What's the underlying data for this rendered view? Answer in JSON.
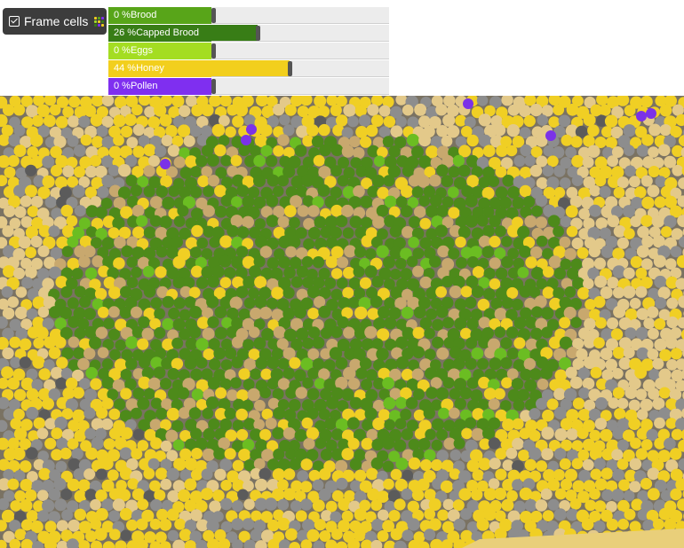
{
  "toggle": {
    "label": "Frame cells",
    "checked": true
  },
  "stats": [
    {
      "label": "0 %Brood",
      "percent": 0,
      "color": "#58a519"
    },
    {
      "label": "26 %Capped Brood",
      "percent": 26,
      "color": "#387d16"
    },
    {
      "label": "0 %Eggs",
      "percent": 0,
      "color": "#a4dd22"
    },
    {
      "label": "44 %Honey",
      "percent": 44,
      "color": "#f2cf1d"
    },
    {
      "label": "0 %Pollen",
      "percent": 0,
      "color": "#7f2ff0"
    }
  ],
  "colors": {
    "capped_brood": "#4d8a1a",
    "brood": "#6bbd22",
    "honey": "#f0cf24",
    "pollen": "#7b32e8",
    "empty_light": "#e3c98a",
    "empty_dark": "#8d8d8d",
    "wax": "#c8a86e"
  },
  "icons": {
    "toggle": "checkbox-icon",
    "cells": "grid-icon"
  }
}
